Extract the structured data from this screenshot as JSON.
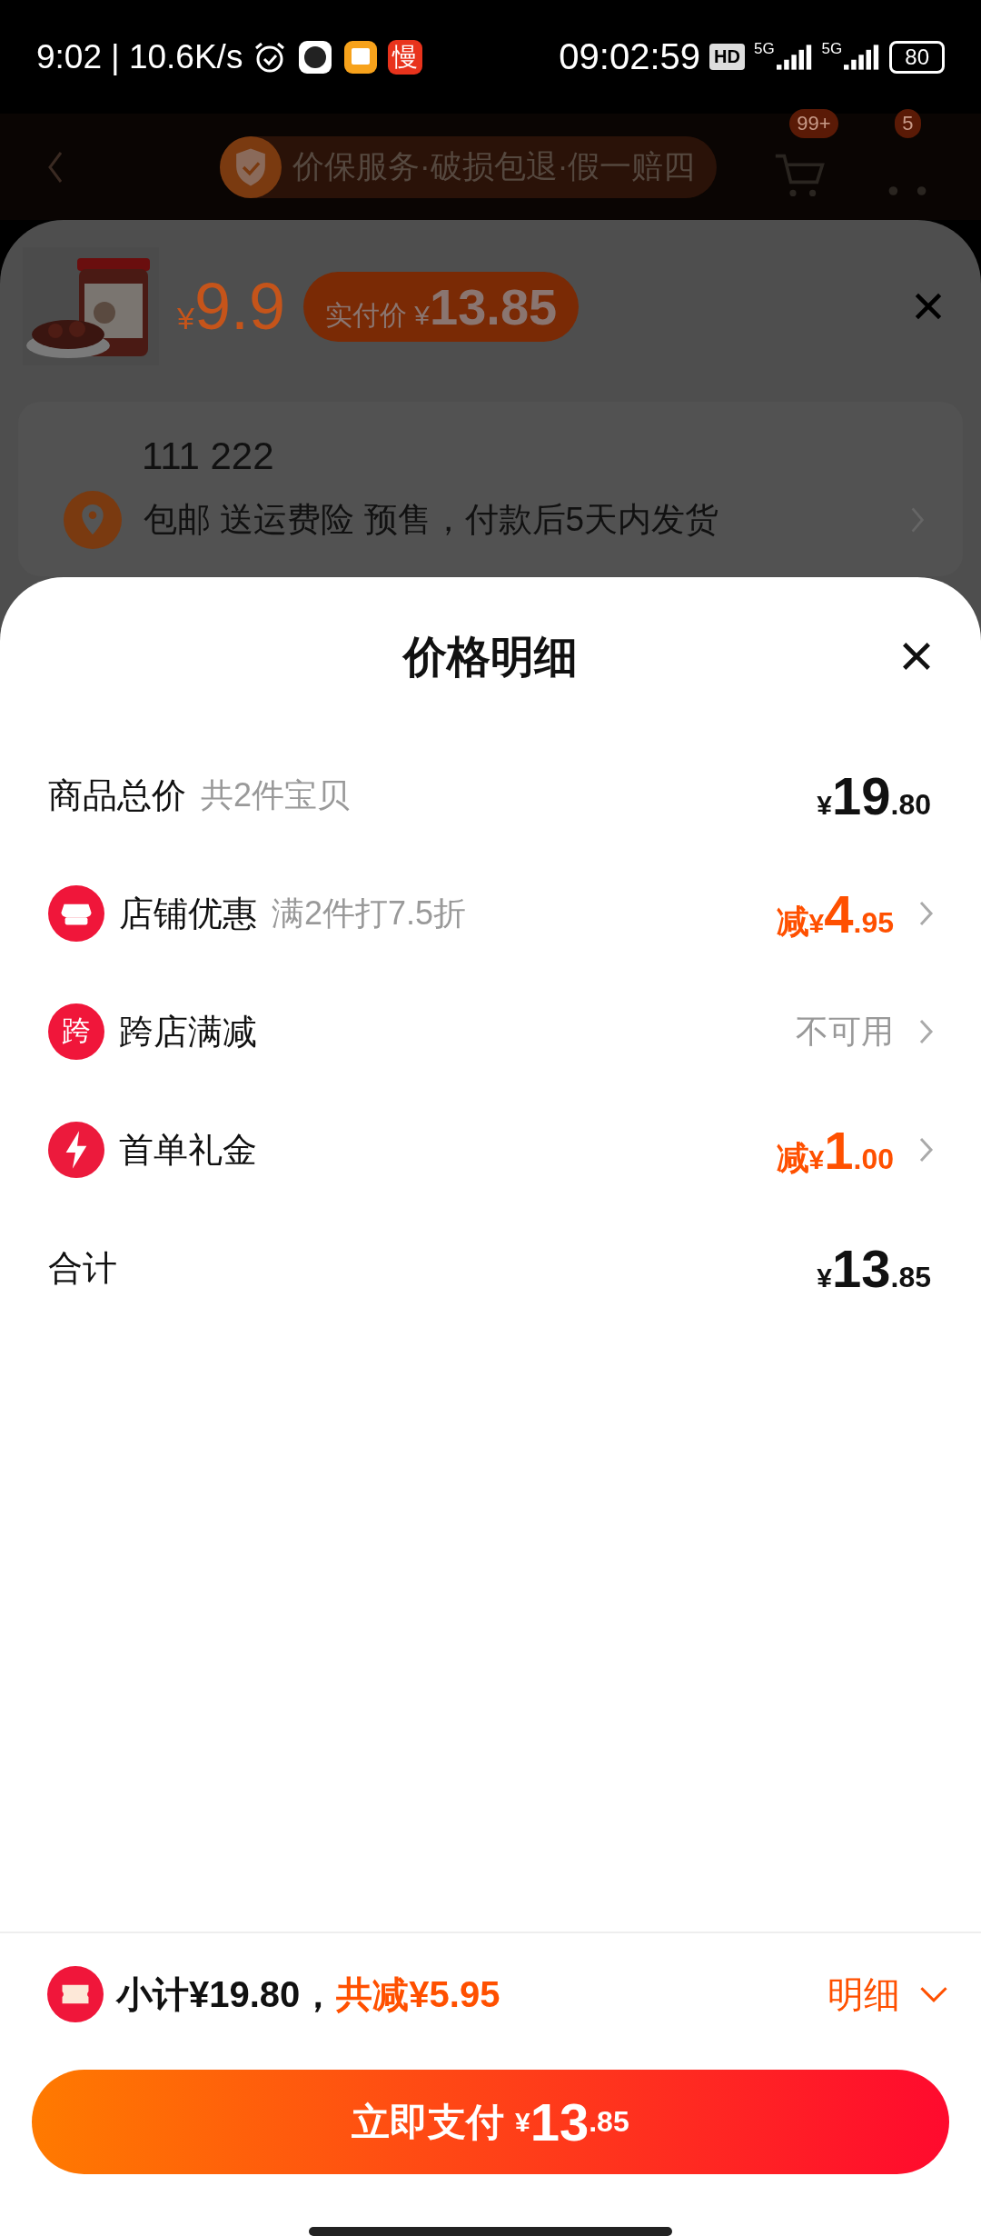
{
  "status_bar": {
    "time": "9:02",
    "speed": "| 10.6K/s",
    "app_badge": "慢",
    "clock": "09:02:59",
    "hd": "HD",
    "networks": [
      "5G",
      "5G"
    ],
    "battery": "80"
  },
  "header": {
    "banner": "价保服务·破损包退·假一赔四",
    "cart_badge": "99+",
    "more_badge": "5"
  },
  "product": {
    "price_currency": "¥",
    "price": "9.9",
    "actual_label": "实付价",
    "actual_currency": "¥",
    "actual_price": "13.85"
  },
  "address": {
    "name": "111 222",
    "shipping": "包邮 送运费险 预售，付款后5天内发货"
  },
  "price_detail": {
    "title": "价格明细",
    "rows": [
      {
        "kind": "plain",
        "label": "商品总价",
        "note": "共2件宝贝",
        "prefix": "",
        "currency": "¥",
        "integer": "19",
        "decimal": ".80"
      },
      {
        "kind": "shop_discount",
        "label": "店铺优惠",
        "note": "满2件打7.5折",
        "prefix": "减",
        "currency": "¥",
        "integer": "4",
        "decimal": ".95"
      },
      {
        "kind": "cross_store",
        "icon_text": "跨",
        "label": "跨店满减",
        "status": "不可用"
      },
      {
        "kind": "first_order_gift",
        "label": "首单礼金",
        "prefix": "减",
        "currency": "¥",
        "integer": "1",
        "decimal": ".00"
      },
      {
        "kind": "plain",
        "label": "合计",
        "prefix": "",
        "currency": "¥",
        "integer": "13",
        "decimal": ".85"
      }
    ]
  },
  "footer": {
    "subtotal": "小计¥19.80，",
    "saved": "共减¥5.95",
    "detail_toggle": "明细",
    "pay_label": "立即支付",
    "pay_currency": "¥",
    "pay_integer": "13",
    "pay_decimal": ".85"
  }
}
